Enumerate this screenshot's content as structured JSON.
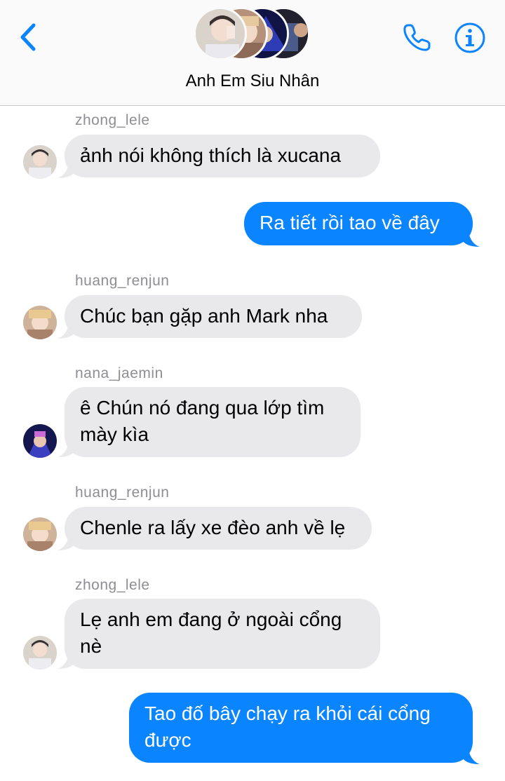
{
  "header": {
    "group_name": "Anh Em Siu Nhân",
    "icons": [
      "back-chevron-icon",
      "phone-icon",
      "info-icon"
    ],
    "accent_color": "#0a84ff"
  },
  "messages": [
    {
      "type": "in",
      "sender": "zhong_lele",
      "text": "ảnh nói không thích là xucana"
    },
    {
      "type": "out",
      "text": "Ra tiết rồi tao về đây"
    },
    {
      "type": "in",
      "sender": "huang_renjun",
      "text": "Chúc bạn gặp anh Mark nha"
    },
    {
      "type": "in",
      "sender": "nana_jaemin",
      "lines": [
        "ê Chún nó đang qua lớp tìm",
        "mày kìa"
      ]
    },
    {
      "type": "in",
      "sender": "huang_renjun",
      "text": "Chenle ra lấy xe đèo anh về lẹ"
    },
    {
      "type": "in",
      "sender": "zhong_lele",
      "lines": [
        "Lẹ anh em đang ở ngoài cổng",
        "nè"
      ]
    },
    {
      "type": "out",
      "lines": [
        "Tao đố bây chạy ra khỏi cái cổng",
        "được"
      ]
    }
  ],
  "colors": {
    "incoming_bubble": "#e9e9eb",
    "outgoing_bubble": "#0a84ff",
    "sender_name": "#8e8e93"
  }
}
